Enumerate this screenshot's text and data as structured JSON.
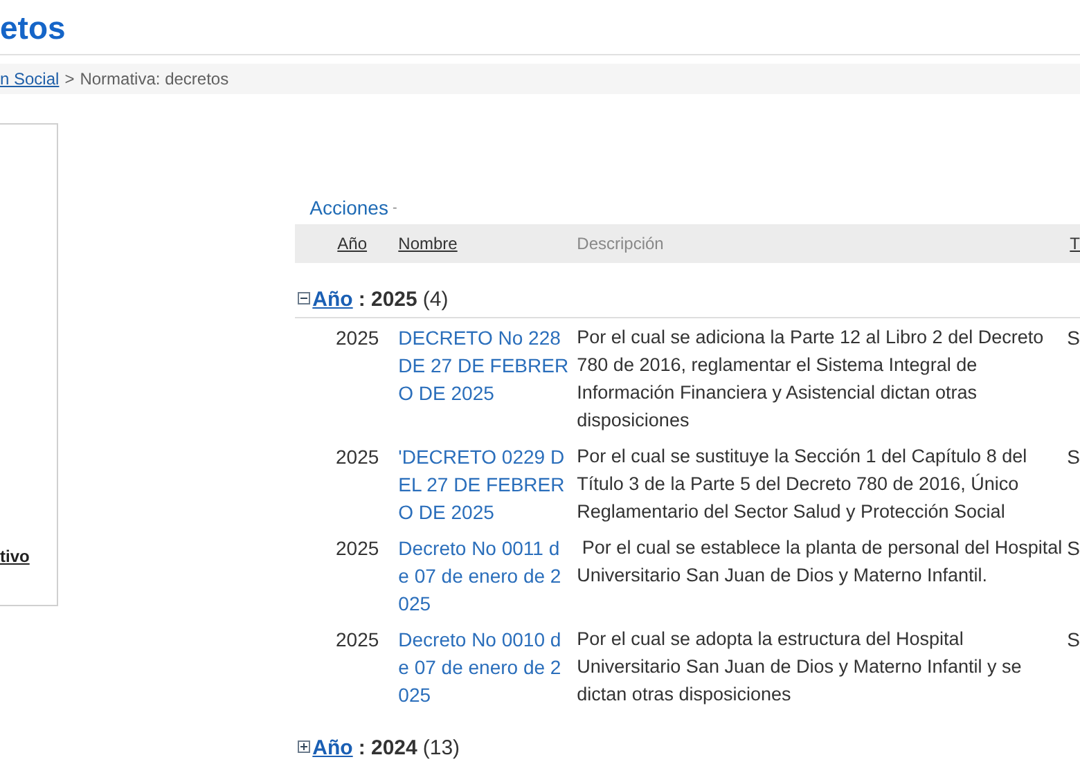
{
  "page_title": "etos",
  "breadcrumb": {
    "link": "n Social",
    "separator": ">",
    "current": "Normativa: decretos"
  },
  "side_panel": {
    "link": "tivo"
  },
  "actions": {
    "label": "Acciones",
    "caret": "-"
  },
  "table": {
    "columns": [
      "Año",
      "Nombre",
      "Descripción",
      "T"
    ],
    "groups": [
      {
        "label": "Año",
        "year": ": 2025",
        "count": "(4)",
        "expanded": true,
        "rows": [
          {
            "year": "2025",
            "name": "DECRETO No 228 DE 27 DE FEBRERO DE 2025",
            "description": "Por el cual se adiciona la Parte 12 al Libro 2 del Decreto 780 de 2016, reglamentar el Sistema Integral de Información Financiera y Asistencial dictan otras disposiciones",
            "column_4": "S"
          },
          {
            "year": "2025",
            "name": "'DECRETO 0229 DEL 27 DE FEBRERO DE 2025",
            "description": "Por el cual se sustituye la Sección 1 del Capítulo 8 del Título 3 de la Parte 5 del Decreto 780 de 2016, Único Reglamentario del Sector Salud y Protección Social",
            "column_4": "S"
          },
          {
            "year": "2025",
            "name": "Decreto No 0011 de 07 de enero de 2025",
            "description": " Por el cual se establece la planta de personal del Hospital Universitario San Juan de Dios y Materno Infantil.",
            "column_4": "S"
          },
          {
            "year": "2025",
            "name": "Decreto No 0010 de 07 de enero de 2025",
            "description": "Por el cual se adopta la estructura del Hospital Universitario San Juan de Dios y Materno Infantil y se dictan otras disposiciones",
            "column_4": "S"
          }
        ]
      },
      {
        "label": "Año",
        "year": ": 2024",
        "count": "(13)",
        "expanded": false
      }
    ]
  }
}
